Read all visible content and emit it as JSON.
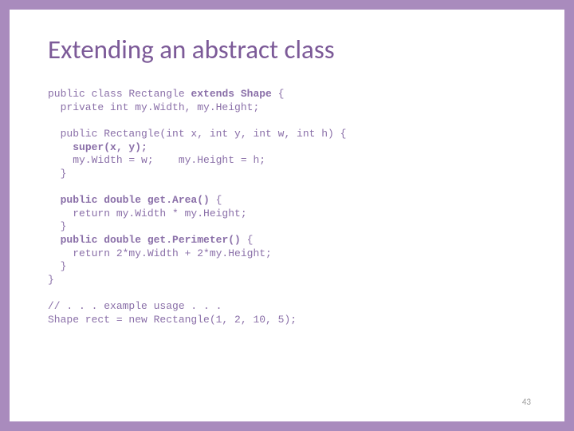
{
  "title": "Extending an abstract class",
  "code": {
    "l01a": "public class Rectangle ",
    "l01b": "extends Shape",
    "l01c": " {",
    "l02": "  private int my.Width, my.Height;",
    "l03": "",
    "l04": "  public Rectangle(int x, int y, int w, int h) {",
    "l05a": "    ",
    "l05b": "super(x, y);",
    "l06": "    my.Width = w;    my.Height = h;",
    "l07": "  }",
    "l08": "",
    "l09a": "  ",
    "l09b": "public double get.Area()",
    "l09c": " {",
    "l10": "    return my.Width * my.Height;",
    "l11": "  }",
    "l12a": "  ",
    "l12b": "public double get.Perimeter()",
    "l12c": " {",
    "l13": "    return 2*my.Width + 2*my.Height;",
    "l14": "  }",
    "l15": "}",
    "l16": "",
    "l17": "// . . . example usage . . .",
    "l18": "Shape rect = new Rectangle(1, 2, 10, 5);"
  },
  "pagenum": "43"
}
